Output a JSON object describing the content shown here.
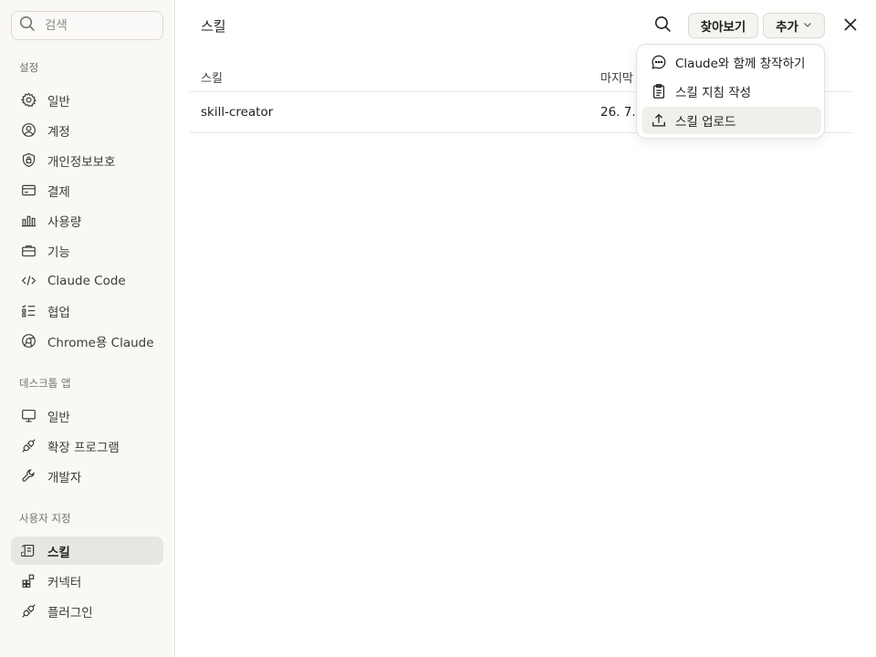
{
  "sidebar": {
    "search": {
      "placeholder": "검색",
      "icon": "search-icon"
    },
    "sections": [
      {
        "label": "설정",
        "items": [
          {
            "label": "일반",
            "icon": "gear-icon"
          },
          {
            "label": "계정",
            "icon": "user-circle-icon"
          },
          {
            "label": "개인정보보호",
            "icon": "shield-lock-icon"
          },
          {
            "label": "결제",
            "icon": "credit-card-icon"
          },
          {
            "label": "사용량",
            "icon": "bar-chart-icon"
          },
          {
            "label": "기능",
            "icon": "briefcase-icon"
          },
          {
            "label": "Claude Code",
            "icon": "code-icon"
          },
          {
            "label": "협업",
            "icon": "checklist-icon"
          },
          {
            "label": "Chrome용 Claude",
            "icon": "globe-icon"
          }
        ]
      },
      {
        "label": "데스크톱 앱",
        "items": [
          {
            "label": "일반",
            "icon": "monitor-icon"
          },
          {
            "label": "확장 프로그램",
            "icon": "plug-icon"
          },
          {
            "label": "개발자",
            "icon": "wrench-icon"
          }
        ]
      },
      {
        "label": "사용자 지정",
        "items": [
          {
            "label": "스킬",
            "icon": "scroll-icon",
            "active": true
          },
          {
            "label": "커넥터",
            "icon": "blocks-icon"
          },
          {
            "label": "플러그인",
            "icon": "plug-icon"
          }
        ]
      }
    ]
  },
  "main": {
    "title": "스킬",
    "toolbar": {
      "browse_label": "찾아보기",
      "add_label": "추가"
    },
    "table": {
      "headers": [
        "스킬",
        "마지막"
      ],
      "rows": [
        {
          "name": "skill-creator",
          "date": "26. 7. 9"
        }
      ]
    },
    "dropdown": {
      "items": [
        {
          "label": "Claude와 함께 창작하기",
          "icon": "chat-bubble-icon"
        },
        {
          "label": "스킬 지침 작성",
          "icon": "clipboard-icon"
        },
        {
          "label": "스킬 업로드",
          "icon": "upload-icon",
          "highlighted": true
        }
      ]
    }
  },
  "colors": {
    "sidebar_bg": "#f9f8f5",
    "active_item_bg": "#e8e6e0",
    "text_primary": "#1f1e1d",
    "text_muted": "#73716b",
    "border": "#dcd9d2"
  }
}
